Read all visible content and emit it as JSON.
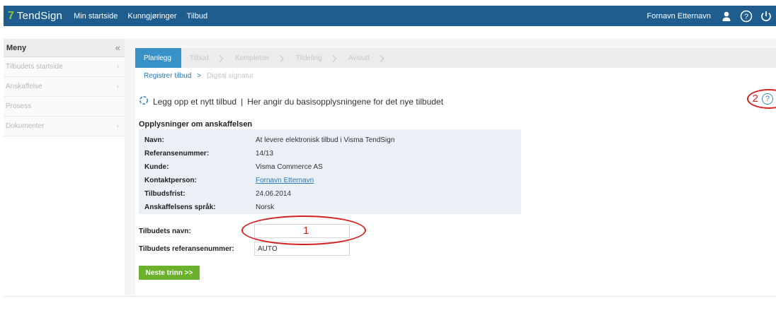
{
  "topbar": {
    "logo_mark": "7",
    "logo_text": "TendSign",
    "nav": [
      "Min startside",
      "Kunngjøringer",
      "Tilbud"
    ],
    "user_name": "Fornavn Etternavn",
    "icons": [
      "user-icon",
      "help-icon",
      "power-icon"
    ]
  },
  "menu": {
    "title": "Meny",
    "collapse": "«",
    "items": [
      {
        "label": "Tilbudets startside",
        "has_arrow": true
      },
      {
        "label": "Anskaffelse",
        "has_arrow": true
      },
      {
        "label": "Prosess",
        "has_arrow": false
      },
      {
        "label": "Dokumenter",
        "has_arrow": true
      }
    ]
  },
  "steps": [
    "Planlegg",
    "Tilbud",
    "Kompletter",
    "Tildeling",
    "Avslutt"
  ],
  "substeps": {
    "active": "Registrer tilbud",
    "arrow": ">",
    "next": "Digital signatur"
  },
  "intro": {
    "text": "Legg opp et nytt tilbud",
    "separator": "|",
    "description": "Her angir du basisopplysningene for det nye tilbudet"
  },
  "help": {
    "annotation": "2",
    "symbol": "?"
  },
  "info": {
    "title": "Opplysninger om anskaffelsen",
    "rows": [
      {
        "label": "Navn:",
        "value": "At levere elektronisk tilbud i Visma TendSign"
      },
      {
        "label": "Referansenummer:",
        "value": "14/13"
      },
      {
        "label": "Kunde:",
        "value": "Visma Commerce AS"
      },
      {
        "label": "Kontaktperson:",
        "value": "Fornavn Etternavn"
      },
      {
        "label": "Tilbudsfrist:",
        "value": "24.06.2014"
      },
      {
        "label": "Anskaffelsens språk:",
        "value": "Norsk"
      }
    ]
  },
  "form": {
    "name_label": "Tilbudets navn:",
    "name_value": "",
    "ref_label": "Tilbudets referansenummer:",
    "ref_value": "AUTO",
    "annotation": "1"
  },
  "next_button": "Neste trinn >>",
  "colors": {
    "topbar": "#1f5d8f",
    "step_active": "#3892c8",
    "button_green": "#6bb12c",
    "annotation_red": "#d32121",
    "link_blue": "#2a78b6"
  }
}
